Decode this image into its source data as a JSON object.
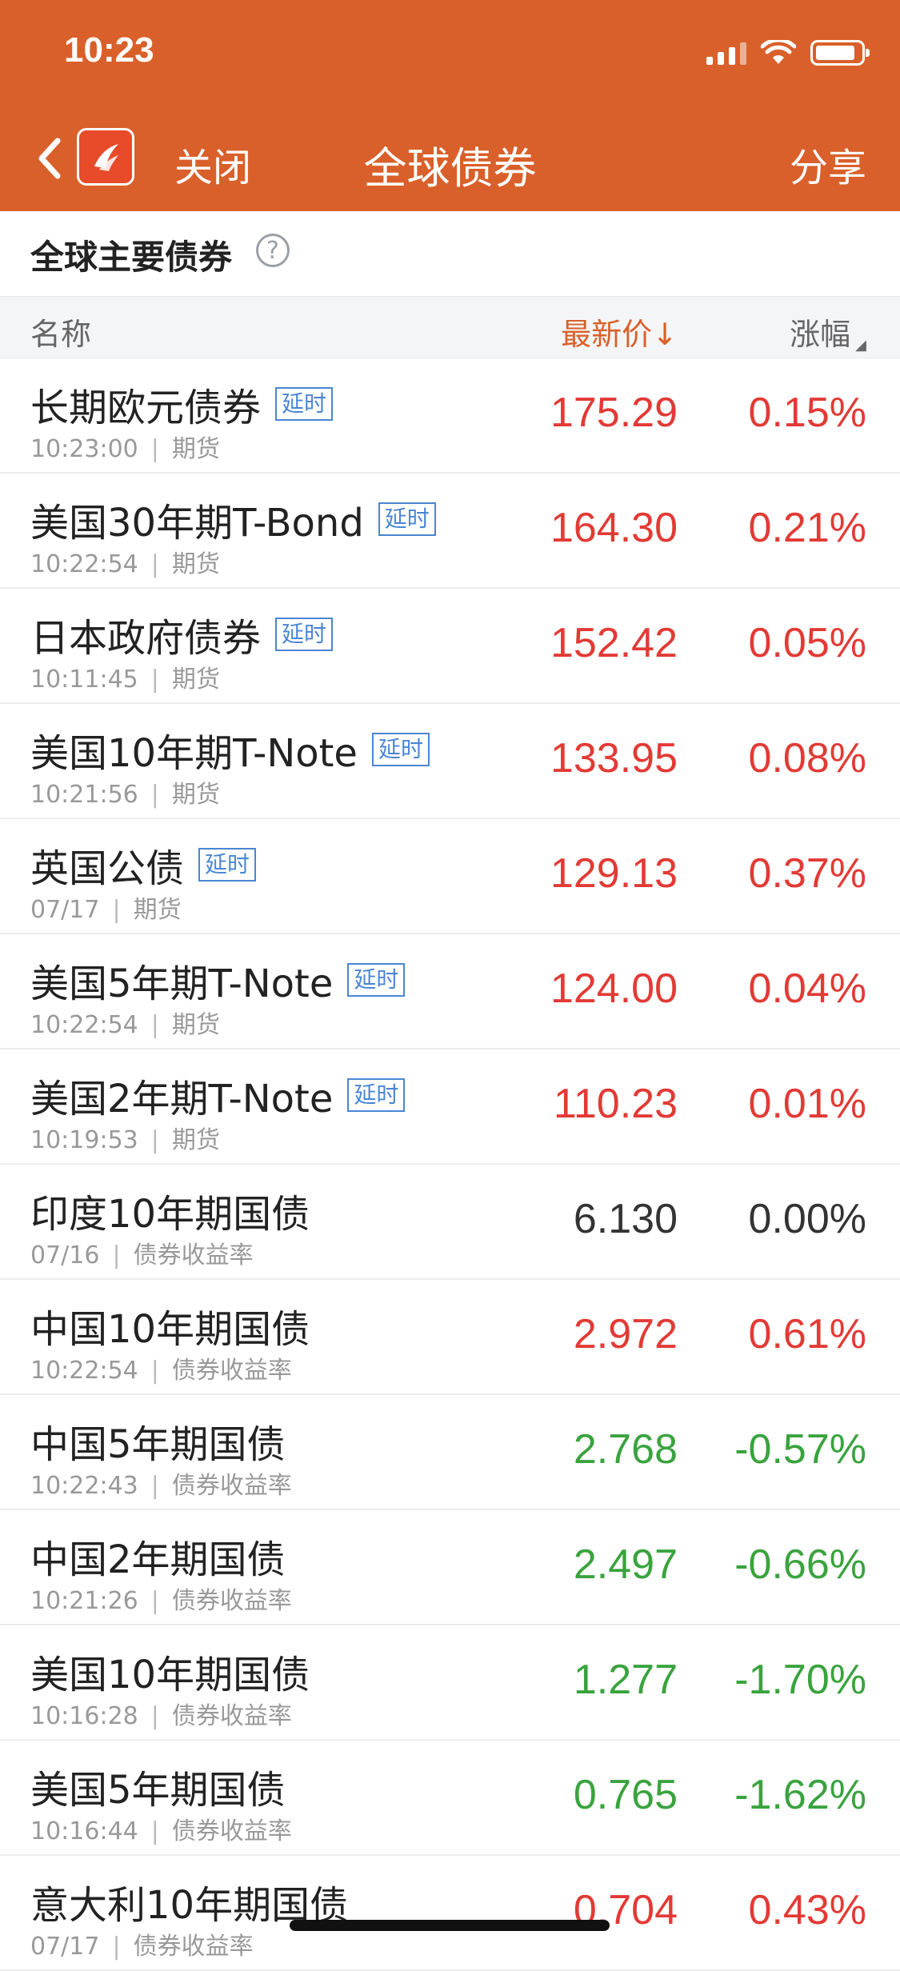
{
  "status_bar": {
    "time": "10:23"
  },
  "nav": {
    "close_label": "关闭",
    "title": "全球债券",
    "share_label": "分享"
  },
  "section": {
    "title": "全球主要债券",
    "help_symbol": "?"
  },
  "columns": {
    "name": "名称",
    "price": "最新价",
    "price_sort": "↓",
    "change": "涨幅",
    "change_sort": "◢"
  },
  "colors": {
    "header_bg": "#d9602a",
    "up": "#e23a35",
    "down": "#3aa33e",
    "tag": "#4a86d4"
  },
  "rows": [
    {
      "name": "长期欧元债券",
      "tag": "延时",
      "time": "10:23:00",
      "sep": "|",
      "type": "期货",
      "price": "175.29",
      "change": "0.15%",
      "trend": "up"
    },
    {
      "name": "美国30年期T-Bond",
      "tag": "延时",
      "time": "10:22:54",
      "sep": "|",
      "type": "期货",
      "price": "164.30",
      "change": "0.21%",
      "trend": "up"
    },
    {
      "name": "日本政府债券",
      "tag": "延时",
      "time": "10:11:45",
      "sep": "|",
      "type": "期货",
      "price": "152.42",
      "change": "0.05%",
      "trend": "up"
    },
    {
      "name": "美国10年期T-Note",
      "tag": "延时",
      "time": "10:21:56",
      "sep": "|",
      "type": "期货",
      "price": "133.95",
      "change": "0.08%",
      "trend": "up"
    },
    {
      "name": "英国公债",
      "tag": "延时",
      "time": "07/17",
      "sep": "|",
      "type": "期货",
      "price": "129.13",
      "change": "0.37%",
      "trend": "up"
    },
    {
      "name": "美国5年期T-Note",
      "tag": "延时",
      "time": "10:22:54",
      "sep": "|",
      "type": "期货",
      "price": "124.00",
      "change": "0.04%",
      "trend": "up"
    },
    {
      "name": "美国2年期T-Note",
      "tag": "延时",
      "time": "10:19:53",
      "sep": "|",
      "type": "期货",
      "price": "110.23",
      "change": "0.01%",
      "trend": "up"
    },
    {
      "name": "印度10年期国债",
      "tag": "",
      "time": "07/16",
      "sep": "|",
      "type": "债券收益率",
      "price": "6.130",
      "change": "0.00%",
      "trend": "flat"
    },
    {
      "name": "中国10年期国债",
      "tag": "",
      "time": "10:22:54",
      "sep": "|",
      "type": "债券收益率",
      "price": "2.972",
      "change": "0.61%",
      "trend": "up"
    },
    {
      "name": "中国5年期国债",
      "tag": "",
      "time": "10:22:43",
      "sep": "|",
      "type": "债券收益率",
      "price": "2.768",
      "change": "-0.57%",
      "trend": "down"
    },
    {
      "name": "中国2年期国债",
      "tag": "",
      "time": "10:21:26",
      "sep": "|",
      "type": "债券收益率",
      "price": "2.497",
      "change": "-0.66%",
      "trend": "down"
    },
    {
      "name": "美国10年期国债",
      "tag": "",
      "time": "10:16:28",
      "sep": "|",
      "type": "债券收益率",
      "price": "1.277",
      "change": "-1.70%",
      "trend": "down"
    },
    {
      "name": "美国5年期国债",
      "tag": "",
      "time": "10:16:44",
      "sep": "|",
      "type": "债券收益率",
      "price": "0.765",
      "change": "-1.62%",
      "trend": "down"
    },
    {
      "name": "意大利10年期国债",
      "tag": "",
      "time": "07/17",
      "sep": "|",
      "type": "债券收益率",
      "price": "0.704",
      "change": "0.43%",
      "trend": "up"
    }
  ]
}
